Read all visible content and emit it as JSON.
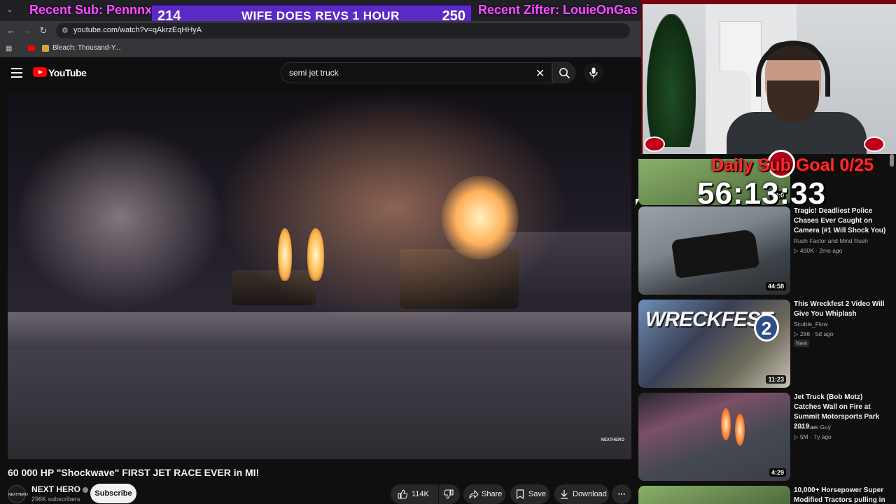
{
  "stream_overlay": {
    "recent_sub": "Recent Sub: Pennnx",
    "bar_left": "214",
    "bar_center": "WIFE DOES REVS 1 HOUR",
    "bar_right": "250",
    "recent_zifter": "Recent Zifter: LouieOnGas",
    "daily_goal": "Daily Sub Goal 0/25",
    "timer": "56:13:33"
  },
  "browser": {
    "url": "youtube.com/watch?v=qAkrzEqHHyA",
    "bookmark": "Bleach: Thousand-Y..."
  },
  "header": {
    "logo_text": "YouTube",
    "search_query": "semi jet truck"
  },
  "video": {
    "title": "60 000 HP \"Shockwave\" FIRST JET RACE EVER in MI!",
    "watermark": "NEXTHERO",
    "channel": {
      "name": "NEXT HERO",
      "avatar_text": "NEXTHERO",
      "subscribers": "296K subscribers",
      "subscribe_label": "Subscribe"
    },
    "actions": {
      "likes": "114K",
      "share": "Share",
      "save": "Save",
      "download": "Download"
    }
  },
  "recommendations": [
    {
      "title": "Tragic! Deadliest Police Chases Ever Caught on Camera (#1 Will Shock You)",
      "channel": "Rush Factor and Mind Rush",
      "meta": "▷ 490K · 2mo ago",
      "duration": "44:58"
    },
    {
      "title": "This Wreckfest 2 Video Will Give You Whiplash",
      "channel": "Scuble_Flow",
      "meta": "▷ 286 · 5d ago",
      "badge": "New",
      "duration": "11:23",
      "thumb_text": "WRECKFEST",
      "thumb_num": "2"
    },
    {
      "title": "Jet Truck (Bob Motz) Catches Wall on Fire at Summit Motorsports Park 2019 ...",
      "channel": "The Ram Guy",
      "meta": "▷ 5M · 7y ago",
      "duration": "4:29"
    },
    {
      "title": "10,000+ Horsepower Super Modified Tractors pulling in"
    }
  ],
  "partial_duration": "29:0"
}
